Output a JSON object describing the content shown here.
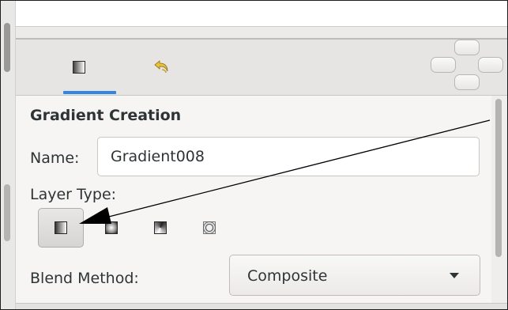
{
  "tabs": [
    {
      "name": "gradient-editor",
      "icon": "gradient-icon",
      "selected": true
    },
    {
      "name": "history",
      "icon": "undo-history-icon",
      "selected": false
    }
  ],
  "panel": {
    "heading": "Gradient Creation",
    "name_label": "Name:",
    "name_value": "Gradient008",
    "layer_type_label": "Layer Type:",
    "layer_types": [
      {
        "icon": "linear-gradient-icon",
        "selected": true
      },
      {
        "icon": "radial-gradient-icon",
        "selected": false
      },
      {
        "icon": "conical-gradient-icon",
        "selected": false
      },
      {
        "icon": "spiral-gradient-icon",
        "selected": false
      }
    ],
    "blend_method_label": "Blend Method:",
    "blend_method_value": "Composite"
  },
  "colors": {
    "accent": "#3584e4",
    "annotation_arrow": "#000000"
  }
}
